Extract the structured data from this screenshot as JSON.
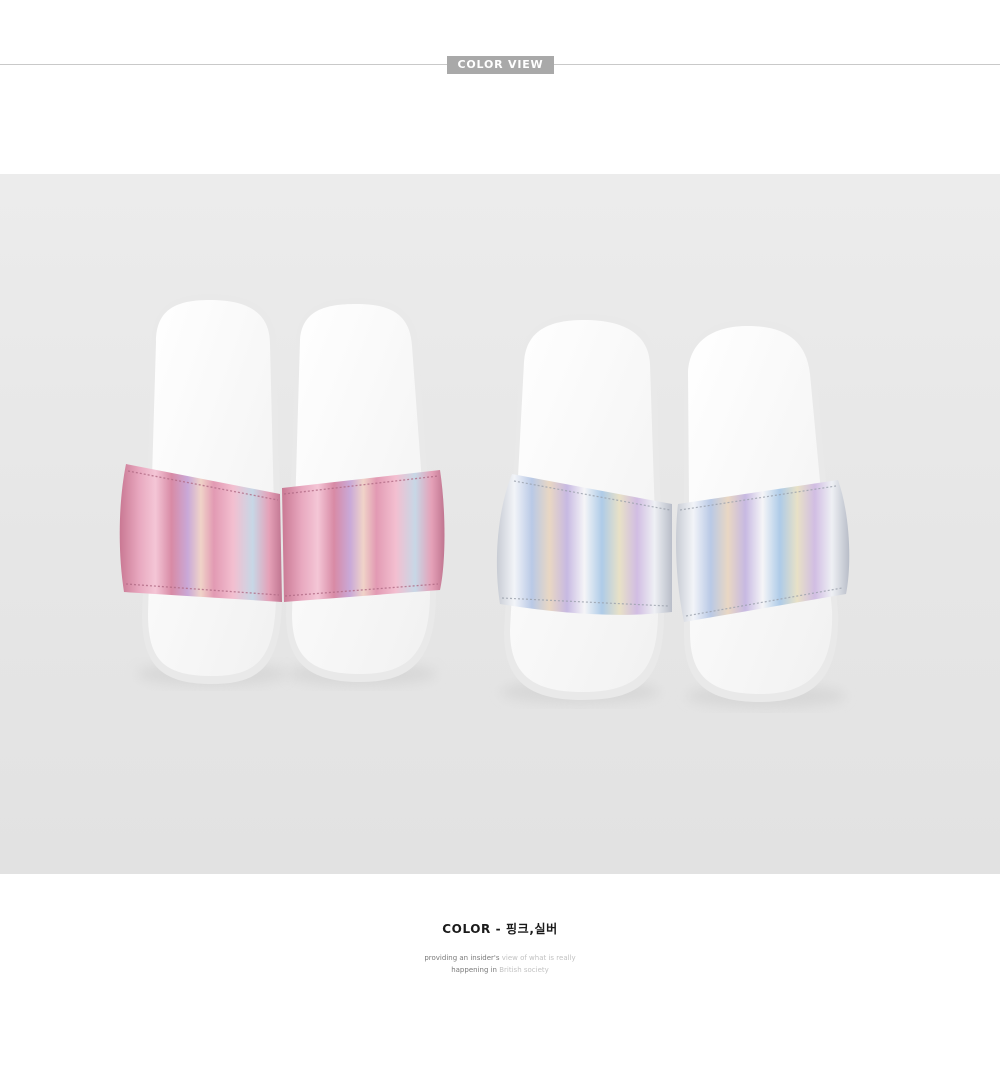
{
  "header": {
    "tag_label": "COLOR VIEW"
  },
  "photo": {
    "subject": "two pairs of hologram slide sandals",
    "pairs": [
      {
        "name": "pink",
        "strap_color": "#d98aa6"
      },
      {
        "name": "silver",
        "strap_color": "#d9dde6"
      }
    ]
  },
  "caption": {
    "color_line": "COLOR - 핑크,실버",
    "tagline": {
      "line1_dark": "providing an insider's",
      "line1_light": "view of what is really",
      "line2_dark": "happening in",
      "line2_light": "British society"
    }
  }
}
